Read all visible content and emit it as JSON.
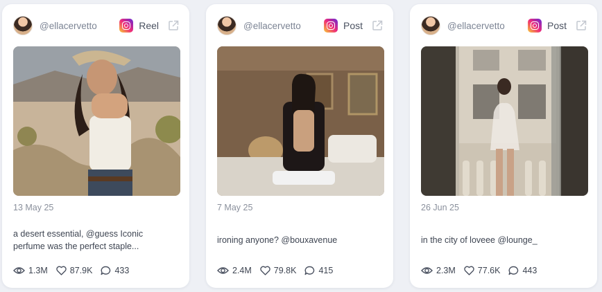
{
  "posts": [
    {
      "handle": "@ellacervetto",
      "type": "Reel",
      "date": "13 May 25",
      "caption": "a desert essential, @guess Iconic perfume was the perfect staple...",
      "views": "1.3M",
      "likes": "87.9K",
      "comments": "433"
    },
    {
      "handle": "@ellacervetto",
      "type": "Post",
      "date": "7 May 25",
      "caption": "ironing anyone? @bouxavenue",
      "views": "2.4M",
      "likes": "79.8K",
      "comments": "415"
    },
    {
      "handle": "@ellacervetto",
      "type": "Post",
      "date": "26 Jun 25",
      "caption": "in the city of loveee @lounge_",
      "views": "2.3M",
      "likes": "77.6K",
      "comments": "443"
    }
  ],
  "icons": {
    "platform": "instagram-icon",
    "open": "external-link-icon",
    "views": "eye-icon",
    "likes": "heart-icon",
    "comments": "comment-icon"
  },
  "colors": {
    "background": "#eef0f5",
    "card": "#ffffff",
    "text": "#3e4552",
    "muted": "#8a909c"
  }
}
